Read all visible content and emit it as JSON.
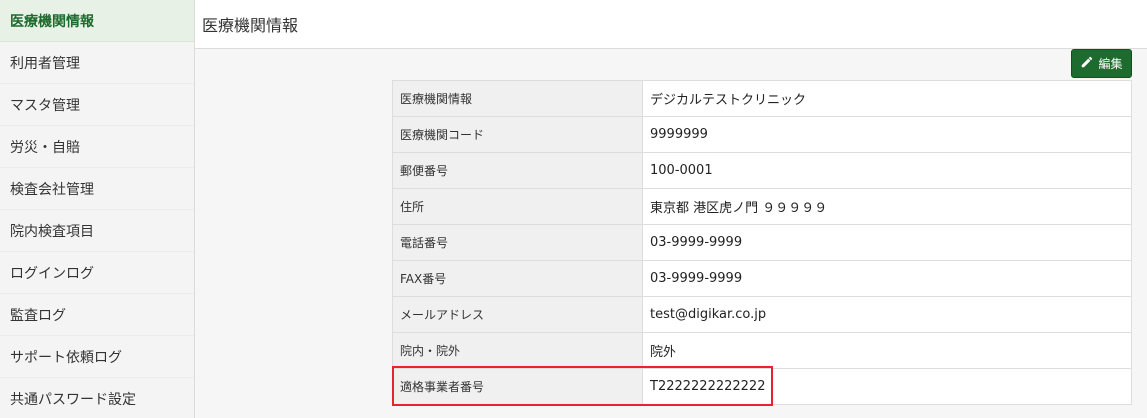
{
  "sidebar": {
    "items": [
      {
        "label": "医療機関情報"
      },
      {
        "label": "利用者管理"
      },
      {
        "label": "マスタ管理"
      },
      {
        "label": "労災・自賠"
      },
      {
        "label": "検査会社管理"
      },
      {
        "label": "院内検査項目"
      },
      {
        "label": "ログインログ"
      },
      {
        "label": "監査ログ"
      },
      {
        "label": "サポート依頼ログ"
      },
      {
        "label": "共通パスワード設定"
      }
    ]
  },
  "header": {
    "title": "医療機関情報"
  },
  "toolbar": {
    "edit_label": "編集",
    "edit_icon": "pencil-icon"
  },
  "info": {
    "rows": [
      {
        "label": "医療機関情報",
        "value": "デジカルテストクリニック"
      },
      {
        "label": "医療機関コード",
        "value": "9999999"
      },
      {
        "label": "郵便番号",
        "value": "100-0001"
      },
      {
        "label": "住所",
        "value": "東京都 港区虎ノ門 ９９９９９"
      },
      {
        "label": "電話番号",
        "value": "03-9999-9999"
      },
      {
        "label": "FAX番号",
        "value": "03-9999-9999"
      },
      {
        "label": "メールアドレス",
        "value": "test@digikar.co.jp"
      },
      {
        "label": "院内・院外",
        "value": "院外"
      },
      {
        "label": "適格事業者番号",
        "value": "T2222222222222"
      }
    ]
  },
  "colors": {
    "accent": "#1e6b2f",
    "highlight": "#e8232f"
  }
}
